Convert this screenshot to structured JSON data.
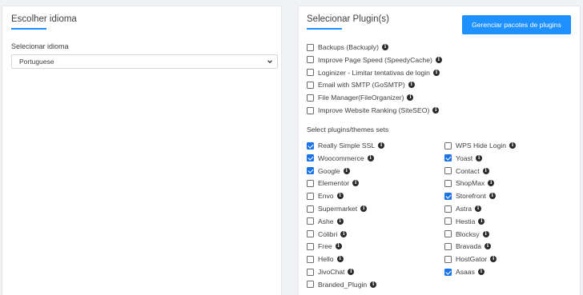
{
  "language_panel": {
    "title": "Escolher idioma",
    "field_label": "Selecionar idioma",
    "selected_language": "Portuguese"
  },
  "plugin_panel": {
    "title": "Selecionar Plugin(s)",
    "manage_button_label": "Gerenciar pacotes de plugins",
    "plugins": [
      {
        "label": "Backups (Backuply)",
        "checked": false
      },
      {
        "label": "Improve Page Speed (SpeedyCache)",
        "checked": false
      },
      {
        "label": "Loginizer - Limitar tentativas de login",
        "checked": false
      },
      {
        "label": "Email with SMTP (GoSMTP)",
        "checked": false
      },
      {
        "label": "File Manager(FileOrganizer)",
        "checked": false
      },
      {
        "label": "Improve Website Ranking (SiteSEO)",
        "checked": false
      }
    ],
    "sets_label": "Select plugins/themes sets",
    "sets_left": [
      {
        "label": "Really Simple SSL",
        "checked": true
      },
      {
        "label": "Woocommerce",
        "checked": true
      },
      {
        "label": "Google",
        "checked": true
      },
      {
        "label": "Elementor",
        "checked": false
      },
      {
        "label": "Envo",
        "checked": false
      },
      {
        "label": "Supermarket",
        "checked": false
      },
      {
        "label": "Ashe",
        "checked": false
      },
      {
        "label": "Colibri",
        "checked": false
      },
      {
        "label": "Free",
        "checked": false
      },
      {
        "label": "Hello",
        "checked": false
      },
      {
        "label": "JivoChat",
        "checked": false
      },
      {
        "label": "Branded_Plugin",
        "checked": false
      }
    ],
    "sets_right": [
      {
        "label": "WPS Hide Login",
        "checked": false
      },
      {
        "label": "Yoast",
        "checked": true
      },
      {
        "label": "Contact",
        "checked": false
      },
      {
        "label": "ShopMax",
        "checked": false
      },
      {
        "label": "Storefront",
        "checked": true
      },
      {
        "label": "Astra",
        "checked": false
      },
      {
        "label": "Hestia",
        "checked": false
      },
      {
        "label": "Blocksy",
        "checked": false
      },
      {
        "label": "Bravada",
        "checked": false
      },
      {
        "label": "HostGator",
        "checked": false
      },
      {
        "label": "Asaas",
        "checked": true
      }
    ]
  },
  "icons": {
    "info": "info-icon",
    "dropdown": "chevron-down-icon"
  },
  "colors": {
    "accent": "#1e90ff",
    "checkbox_checked": "#1a73e8",
    "page_background": "#f1f2f5"
  }
}
